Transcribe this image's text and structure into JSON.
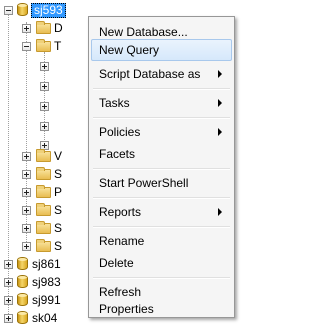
{
  "tree": {
    "root_label": "sj593",
    "child_labels": [
      "D",
      "T",
      "V",
      "S",
      "P",
      "S",
      "S",
      "S"
    ],
    "sibling_servers": [
      "sj861",
      "sj983",
      "sj991",
      "sk04"
    ]
  },
  "context_menu": {
    "items": [
      {
        "label": "New Database...",
        "submenu": false
      },
      {
        "label": "New Query",
        "submenu": false,
        "highlighted": true
      },
      {
        "label": "Script Database as",
        "submenu": true
      },
      {
        "label": "Tasks",
        "submenu": true
      },
      {
        "label": "Policies",
        "submenu": true
      },
      {
        "label": "Facets",
        "submenu": false
      },
      {
        "label": "Start PowerShell",
        "submenu": false
      },
      {
        "label": "Reports",
        "submenu": true
      },
      {
        "label": "Rename",
        "submenu": false
      },
      {
        "label": "Delete",
        "submenu": false
      },
      {
        "label": "Refresh",
        "submenu": false
      },
      {
        "label": "Properties",
        "submenu": false
      }
    ]
  },
  "colors": {
    "selection": "#3399ff",
    "menu_background": "#f5f5f5",
    "hover_background": "#d6e8fb"
  }
}
